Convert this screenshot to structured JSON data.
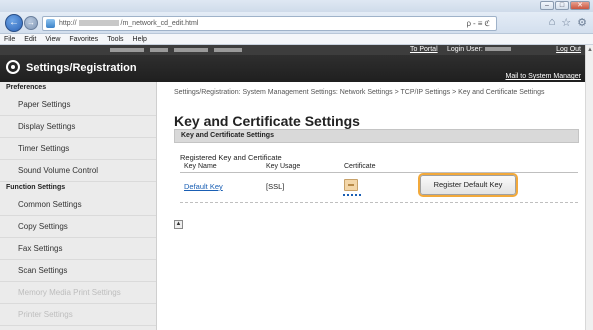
{
  "browser": {
    "address_prefix": "http://",
    "address_suffix": "/m_network_cd_edit.html",
    "address_tools": "ρ-≡ℭ",
    "back_glyph": "←",
    "forward_glyph": "→",
    "menu": [
      "File",
      "Edit",
      "View",
      "Favorites",
      "Tools",
      "Help"
    ],
    "home_glyphs": [
      "⌂",
      "☆",
      "⚙"
    ]
  },
  "app": {
    "to_portal": "To Portal",
    "login_user_label": "Login User:",
    "log_out": "Log Out",
    "title": "Settings/Registration",
    "mail_link": "Mail to System Manager"
  },
  "sidebar": {
    "preferences_heading": "Preferences",
    "preferences_items": [
      "Paper Settings",
      "Display Settings",
      "Timer Settings",
      "Sound Volume Control"
    ],
    "function_heading": "Function Settings",
    "function_items": [
      "Common Settings",
      "Copy Settings",
      "Fax Settings",
      "Scan Settings",
      "Memory Media Print Settings",
      "Printer Settings"
    ]
  },
  "main": {
    "breadcrumb": "Settings/Registration: System Management Settings: Network Settings > TCP/IP Settings > Key and Certificate Settings",
    "page_title": "Key and Certificate Settings",
    "section_title": "Key and Certificate Settings",
    "registered_label": "Registered Key and Certificate",
    "columns": [
      "Key Name",
      "Key Usage",
      "Certificate"
    ],
    "row": {
      "key_name": "Default Key",
      "key_usage": "[SSL]"
    },
    "register_button": "Register Default Key",
    "top_button": "▲"
  },
  "colors": {
    "accent_highlight": "#f2a93b",
    "header_bg": "#2f2f2f",
    "link": "#1a5fb4"
  }
}
